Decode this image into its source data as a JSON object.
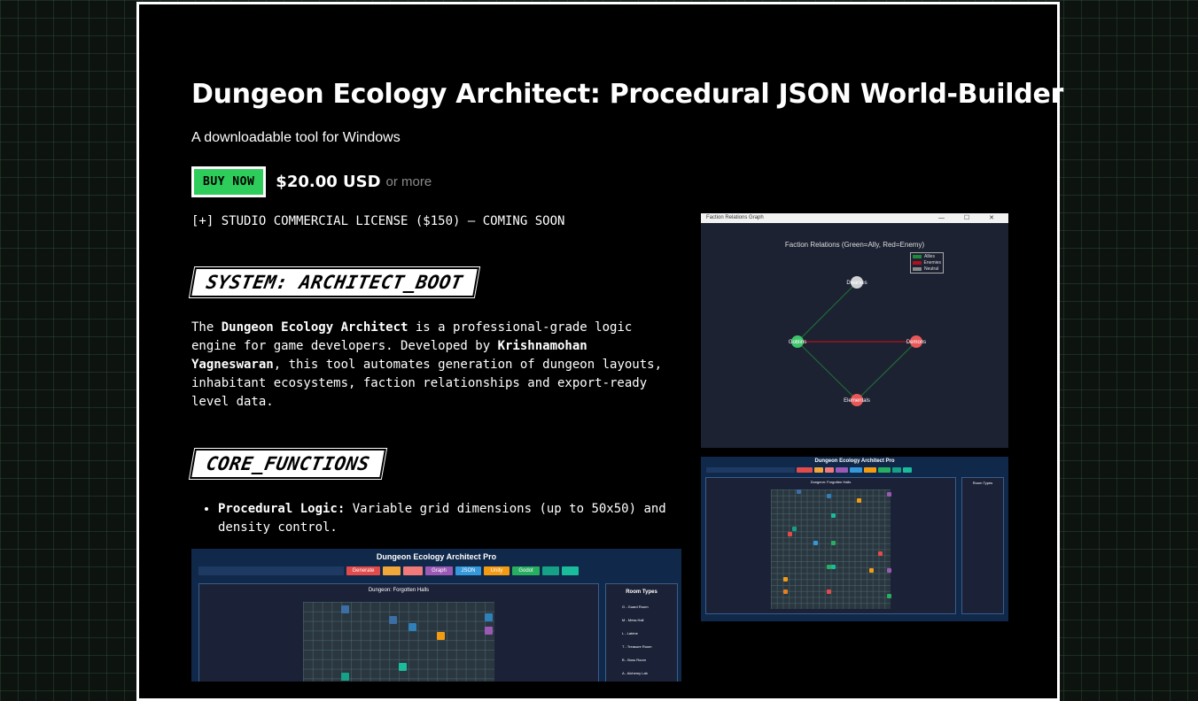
{
  "page": {
    "title": "Dungeon Ecology Architect: Procedural JSON World-Builder",
    "subtitle": "A downloadable tool for Windows",
    "buy_label": "BUY NOW",
    "price": "$20.00 USD",
    "price_suffix": "or more",
    "license_line": "[+] STUDIO COMMERCIAL LICENSE ($150) — COMING SOON"
  },
  "sections": {
    "boot_heading": "SYSTEM: ARCHITECT_BOOT",
    "desc_1": "The ",
    "desc_product": "Dungeon Ecology Architect",
    "desc_2": " is a professional-grade logic engine for game developers. Developed by ",
    "desc_author": "Krishnamohan Yagneswaran",
    "desc_3": ", this tool automates generation of dungeon layouts, inhabitant ecosystems, faction relationships and export-ready level data.",
    "functions_heading": "CORE_FUNCTIONS",
    "features": [
      {
        "label": "Procedural Logic:",
        "text": " Variable grid dimensions (up to 50x50) and density control."
      }
    ]
  },
  "graph_shot": {
    "window_title": "Faction Relations Graph",
    "window_buttons": "—  ☐  ✕",
    "chart_title": "Faction Relations (Green=Ally, Red=Enemy)",
    "legend": [
      {
        "label": "Allies",
        "color": "#1f8a3a"
      },
      {
        "label": "Enemies",
        "color": "#b0101e"
      },
      {
        "label": "Neutral",
        "color": "#8a8a8a"
      }
    ],
    "nodes": [
      {
        "name": "Dwarves",
        "color": "#cfd3d6"
      },
      {
        "name": "Goblins",
        "color": "#3ec46a"
      },
      {
        "name": "Demons",
        "color": "#e85858"
      },
      {
        "name": "Elementals",
        "color": "#e85858"
      }
    ]
  },
  "app_shot": {
    "title": "Dungeon Ecology Architect Pro",
    "dungeon_title": "Dungeon: Forgotten Halls",
    "room_types_title": "Room Types",
    "buttons": [
      {
        "label": "Generate",
        "color": "#e24b4b"
      },
      {
        "label": "",
        "color": "#f0a63a"
      },
      {
        "label": "",
        "color": "#f07a7a"
      },
      {
        "label": "Graph",
        "color": "#9b59b6"
      },
      {
        "label": "JSON",
        "color": "#3498db"
      },
      {
        "label": "Unity",
        "color": "#f39c12"
      },
      {
        "label": "Godot",
        "color": "#27ae60"
      },
      {
        "label": "",
        "color": "#16a085"
      },
      {
        "label": "",
        "color": "#1abc9c"
      }
    ],
    "room_types": [
      "G - Guard Room",
      "M - Mess Hall",
      "L - Latrine",
      "T - Treasure Room",
      "B - Boss Room",
      "A - Alchemy Lab"
    ]
  }
}
